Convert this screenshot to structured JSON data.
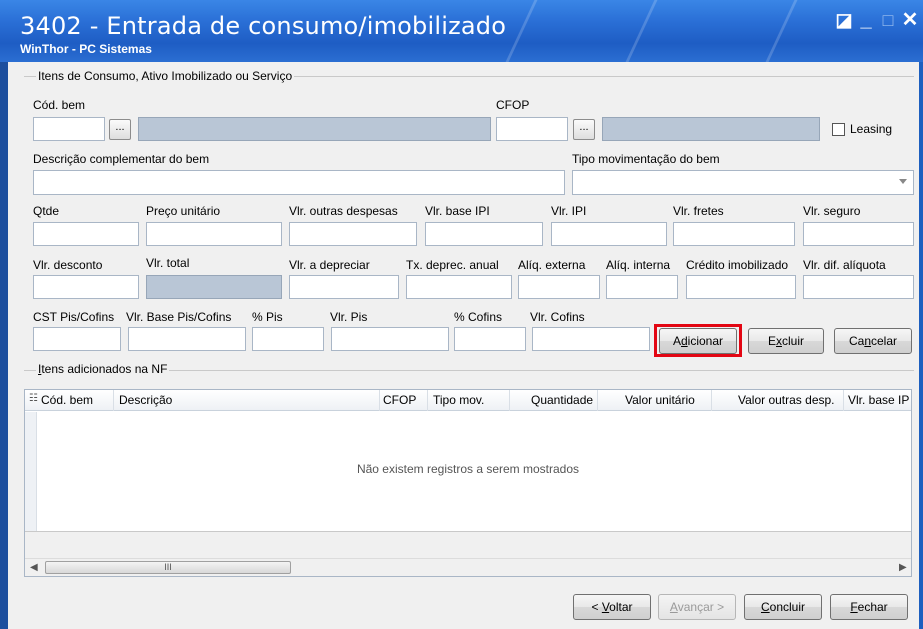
{
  "window": {
    "title": "3402 - Entrada de consumo/imobilizado",
    "subtitle": "WinThor - PC Sistemas"
  },
  "group1": {
    "title": "Itens de Consumo, Ativo Imobilizado ou Serviço"
  },
  "fields": {
    "cod_bem": {
      "label": "Cód. bem",
      "value": "",
      "description": ""
    },
    "cfop": {
      "label": "CFOP",
      "value": "",
      "description": ""
    },
    "leasing": {
      "label": "Leasing",
      "checked": false
    },
    "descricao_complementar": {
      "label": "Descrição complementar do bem",
      "value": ""
    },
    "tipo_movimentacao": {
      "label": "Tipo movimentação do bem",
      "value": ""
    },
    "qtde": {
      "label": "Qtde",
      "value": ""
    },
    "preco_unitario": {
      "label": "Preço unitário",
      "value": ""
    },
    "vlr_outras_despesas": {
      "label": "Vlr. outras despesas",
      "value": ""
    },
    "vlr_base_ipi": {
      "label": "Vlr. base IPI",
      "value": ""
    },
    "vlr_ipi": {
      "label": "Vlr. IPI",
      "value": ""
    },
    "vlr_fretes": {
      "label": "Vlr. fretes",
      "value": ""
    },
    "vlr_seguro": {
      "label": "Vlr. seguro",
      "value": ""
    },
    "vlr_desconto": {
      "label": "Vlr. desconto",
      "value": ""
    },
    "vlr_total": {
      "label": "Vlr. total",
      "value": ""
    },
    "vlr_a_depreciar": {
      "label": "Vlr. a depreciar",
      "value": ""
    },
    "tx_deprec_anual": {
      "label": "Tx. deprec. anual",
      "value": ""
    },
    "aliq_externa": {
      "label": "Alíq. externa",
      "value": ""
    },
    "aliq_interna": {
      "label": "Alíq. interna",
      "value": ""
    },
    "credito_imobilizado": {
      "label": "Crédito imobilizado",
      "value": ""
    },
    "vlr_dif_aliquota": {
      "label": "Vlr. dif. alíquota",
      "value": ""
    },
    "cst_pis_cofins": {
      "label": "CST Pis/Cofins",
      "value": ""
    },
    "vlr_base_pis_cofins": {
      "label": "Vlr. Base Pis/Cofins",
      "value": ""
    },
    "perc_pis": {
      "label": "% Pis",
      "value": ""
    },
    "vlr_pis": {
      "label": "Vlr. Pis",
      "value": ""
    },
    "perc_cofins": {
      "label": "% Cofins",
      "value": ""
    },
    "vlr_cofins": {
      "label": "Vlr. Cofins",
      "value": ""
    }
  },
  "item_buttons": {
    "browse": "...",
    "adicionar": {
      "pre": "A",
      "key": "d",
      "post": "icionar"
    },
    "excluir": {
      "pre": "E",
      "key": "x",
      "post": "cluir"
    },
    "cancelar": {
      "pre": "Ca",
      "key": "n",
      "post": "celar"
    }
  },
  "group2": {
    "pre": "",
    "key": "I",
    "post": "tens adicionados na NF"
  },
  "grid": {
    "columns": [
      "Cód. bem",
      "Descrição",
      "CFOP",
      "Tipo mov.",
      "Quantidade",
      "Valor unitário",
      "Valor outras desp.",
      "Vlr. base IP"
    ],
    "empty_message": "Não existem registros a serem mostrados",
    "scroll_thumb": "III"
  },
  "footer_buttons": {
    "voltar": {
      "pre": "< ",
      "key": "V",
      "post": "oltar",
      "enabled": true
    },
    "avancar": {
      "pre": "",
      "key": "A",
      "post": "vançar >",
      "enabled": false
    },
    "concluir": {
      "pre": "",
      "key": "C",
      "post": "oncluir",
      "enabled": true
    },
    "fechar": {
      "pre": "",
      "key": "F",
      "post": "echar",
      "enabled": true
    }
  },
  "colors": {
    "highlight": "#e30613",
    "title_bar": "#2a6fd6"
  }
}
